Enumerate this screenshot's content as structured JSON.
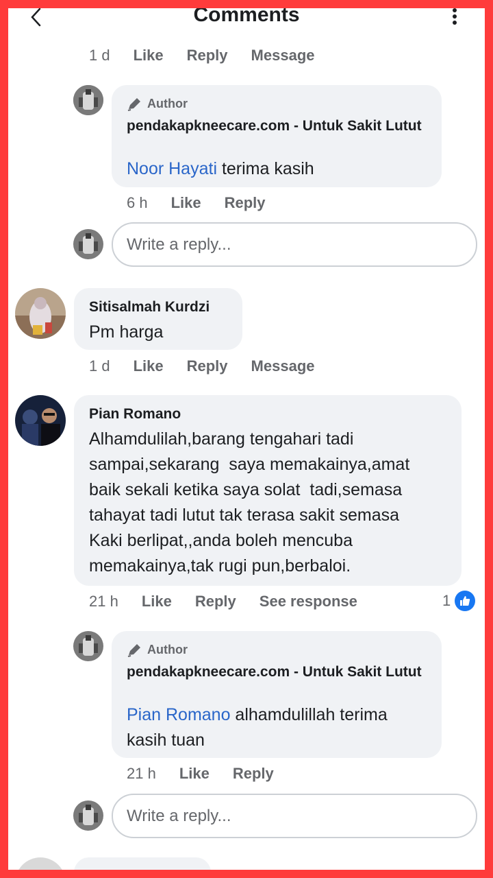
{
  "header": {
    "title": "Comments"
  },
  "thread1": {
    "actions": {
      "time": "1 d",
      "like": "Like",
      "reply": "Reply",
      "message": "Message"
    },
    "author_reply": {
      "tag": "Author",
      "name": "pendakapkneecare.com - Untuk Sakit Lutut",
      "mention": "Noor Hayati",
      "text": " terima kasih",
      "time": "6 h",
      "like": "Like",
      "reply": "Reply"
    },
    "reply_placeholder": "Write a reply..."
  },
  "comment2": {
    "name": "Sitisalmah Kurdzi",
    "text": "Pm harga",
    "time": "1 d",
    "like": "Like",
    "reply": "Reply",
    "message": "Message"
  },
  "comment3": {
    "name": "Pian Romano",
    "lines": [
      "Alhamdulilah,barang tengahari tadi",
      "sampai,sekarang  saya memakainya,amat",
      "baik sekali ketika saya solat  tadi,semasa",
      "tahayat tadi lutut tak terasa sakit semasa",
      "Kaki berlipat,,anda boleh mencuba",
      "memakainya,tak rugi pun,berbaloi."
    ],
    "time": "21 h",
    "like": "Like",
    "reply": "Reply",
    "see_response": "See response",
    "reaction_count": "1",
    "author_reply": {
      "tag": "Author",
      "name": "pendakapkneecare.com - Untuk Sakit Lutut",
      "mention": "Pian Romano",
      "text_line1": " alhamdulillah terima",
      "text_line2": "kasih tuan",
      "time": "21 h",
      "like": "Like",
      "reply": "Reply"
    },
    "reply_placeholder": "Write a reply..."
  },
  "colors": {
    "accent": "#1877f2",
    "mention": "#2a66c9",
    "bubble": "#f0f2f5",
    "frame": "#ff3b3b"
  }
}
